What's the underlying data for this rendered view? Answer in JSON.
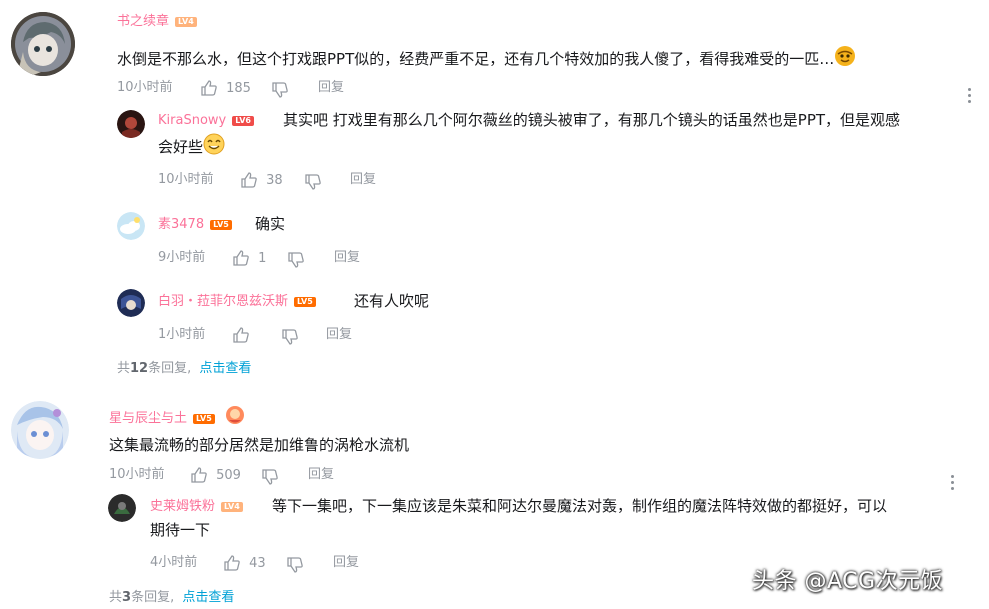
{
  "comments": [
    {
      "user": "书之续章",
      "level": "LV4",
      "text": "水倒是不那么水，但这个打戏跟PPT似的，经费严重不足，还有几个特效加的我人傻了，看得我难受的一匹…",
      "time": "10小时前",
      "likes": "185",
      "reply_label": "回复",
      "replies": [
        {
          "user": "KiraSnowy",
          "level": "LV6",
          "text_line1": "其实吧 打戏里有那么几个阿尔薇丝的镜头被审了，有那几个镜头的话虽然也是PPT，但是观感",
          "text_line2": "会好些",
          "time": "10小时前",
          "likes": "38",
          "reply_label": "回复"
        },
        {
          "user": "素3478",
          "level": "LV5",
          "text": "确实",
          "time": "9小时前",
          "likes": "1",
          "reply_label": "回复"
        },
        {
          "user": "白羽・菈菲尔恩兹沃斯",
          "level": "LV5",
          "text": "还有人吹呢",
          "time": "1小时前",
          "likes": "",
          "reply_label": "回复"
        }
      ],
      "more_prefix": "共",
      "more_count": "12",
      "more_suffix": "条回复,",
      "more_link": "点击查看"
    },
    {
      "user": "星与辰尘与土",
      "level": "LV5",
      "text": "这集最流畅的部分居然是加维鲁的涡枪水流机",
      "time": "10小时前",
      "likes": "509",
      "reply_label": "回复",
      "replies": [
        {
          "user": "史莱姆铁粉",
          "level": "LV4",
          "text_line1": "等下一集吧，下一集应该是朱菜和阿达尔曼魔法对轰，制作组的魔法阵特效做的都挺好，可以",
          "text_line2": "期待一下",
          "time": "4小时前",
          "likes": "43",
          "reply_label": "回复"
        }
      ],
      "more_prefix": "共",
      "more_count": "3",
      "more_suffix": "条回复,",
      "more_link": "点击查看"
    }
  ],
  "watermark": "头条 @ACG次元饭",
  "colors": {
    "username": "#fb7299",
    "link": "#00a1d6",
    "meta": "#9499a0"
  }
}
